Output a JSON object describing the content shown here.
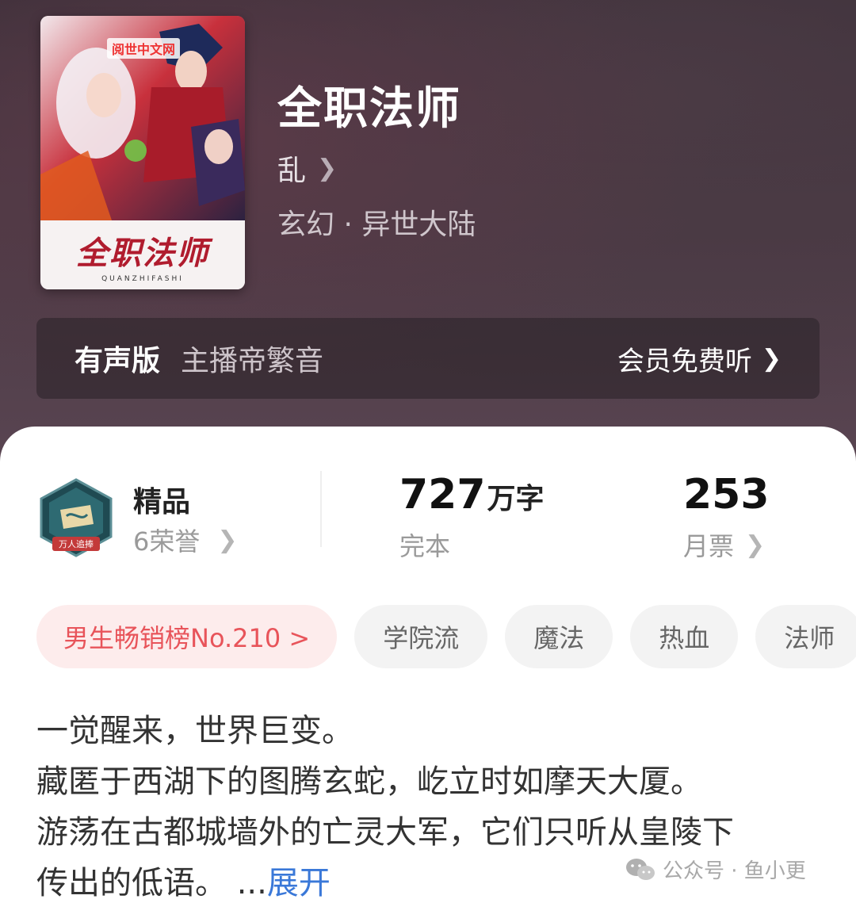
{
  "book": {
    "title": "全职法师",
    "author": "乱",
    "genre": "玄幻 · 异世大陆",
    "cover": {
      "title_art": "全职法师",
      "subtitle": "QUANZHIFASHI",
      "publisher_mark": "阅世中文网"
    }
  },
  "audio": {
    "label": "有声版",
    "host": "主播帝繁音",
    "action": "会员免费听"
  },
  "stats": {
    "premium": {
      "title": "精品",
      "sub": "6荣誉",
      "badge_text": "万人追捧"
    },
    "words": {
      "number": "727",
      "unit": "万字",
      "sub": "完本"
    },
    "monthly": {
      "number": "253",
      "sub": "月票"
    }
  },
  "tags": [
    {
      "label": "男生畅销榜No.210 >",
      "kind": "rank"
    },
    {
      "label": "学院流",
      "kind": "tag"
    },
    {
      "label": "魔法",
      "kind": "tag"
    },
    {
      "label": "热血",
      "kind": "tag"
    },
    {
      "label": "法师",
      "kind": "tag"
    }
  ],
  "synopsis": {
    "lines": [
      "一觉醒来，世界巨变。",
      "藏匿于西湖下的图腾玄蛇，屹立时如摩天大厦。",
      "游荡在古都城墙外的亡灵大军，它们只听从皇陵下",
      "传出的低语。 ..."
    ],
    "expand": "展开"
  },
  "watermark": "公众号 · 鱼小更",
  "colors": {
    "hero_bg": "#4a3a44",
    "rank_tag_bg": "#fdecec",
    "rank_tag_text": "#e8545a",
    "link": "#3a78d8"
  }
}
